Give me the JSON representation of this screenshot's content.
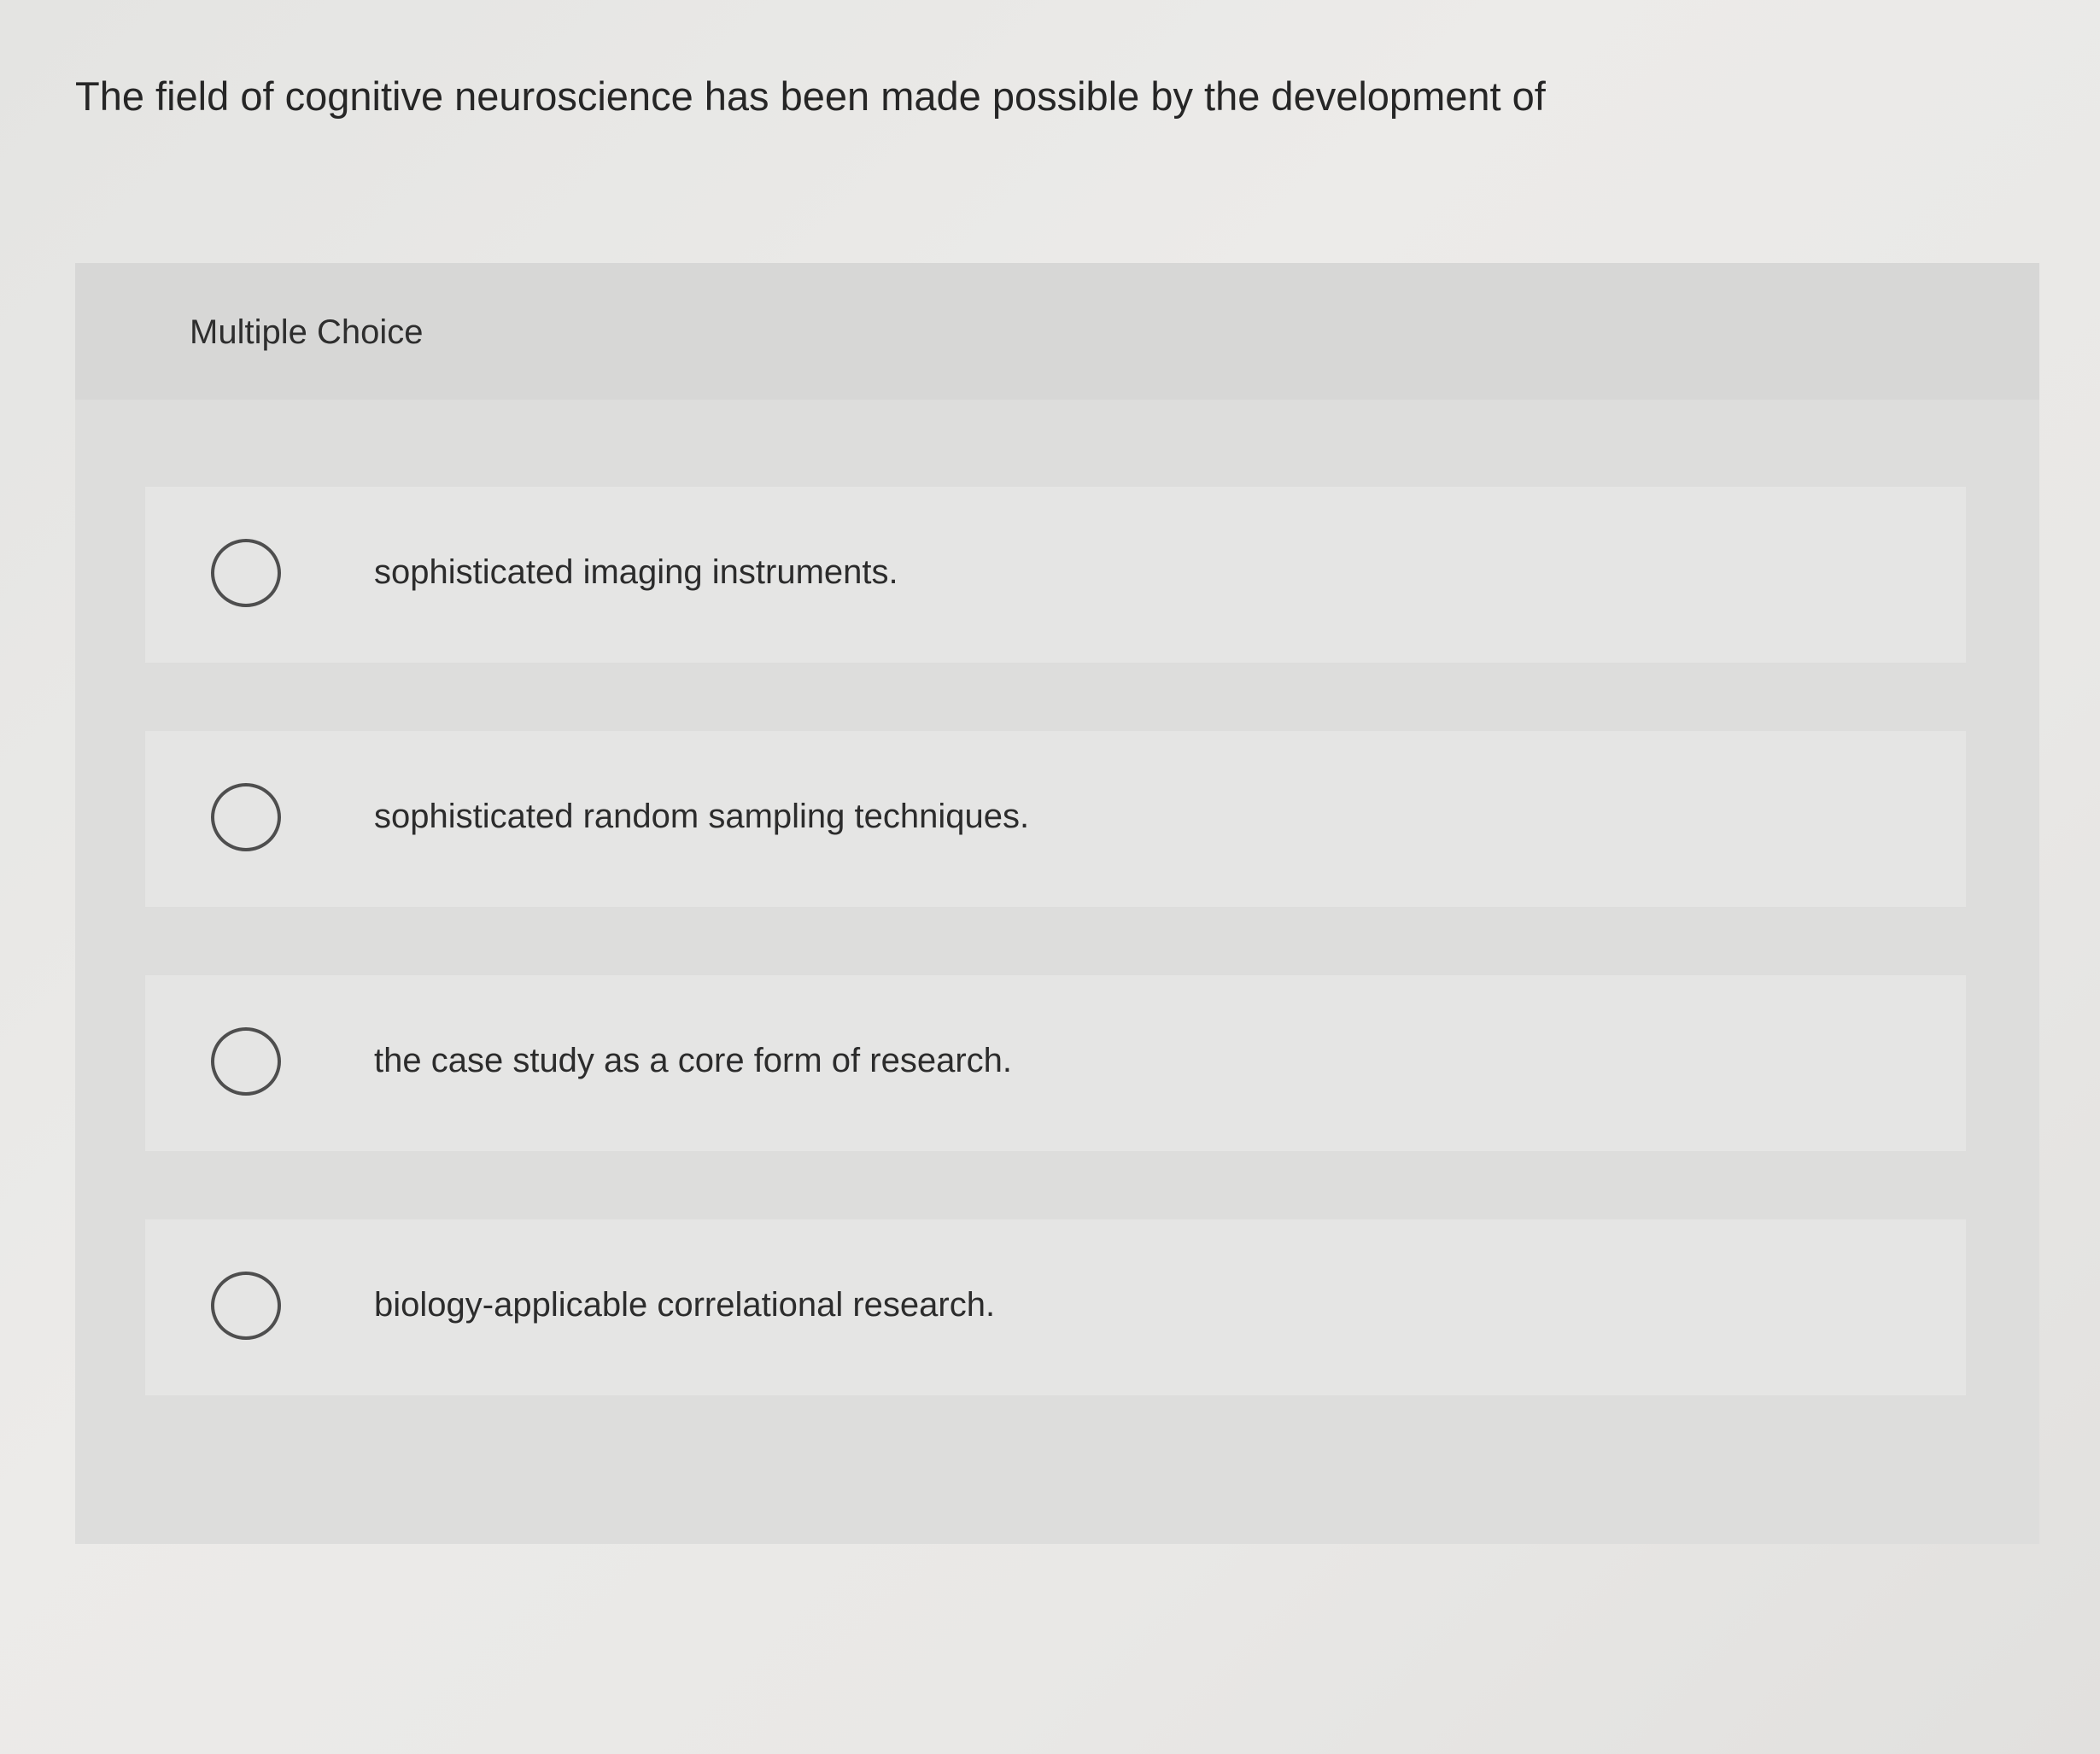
{
  "question": {
    "text": "The field of cognitive neuroscience has been made possible by the development of"
  },
  "multiple_choice": {
    "label": "Multiple Choice",
    "options": [
      {
        "text": "sophisticated imaging instruments."
      },
      {
        "text": "sophisticated random sampling techniques."
      },
      {
        "text": "the case study as a core form of research."
      },
      {
        "text": "biology-applicable correlational research."
      }
    ]
  }
}
